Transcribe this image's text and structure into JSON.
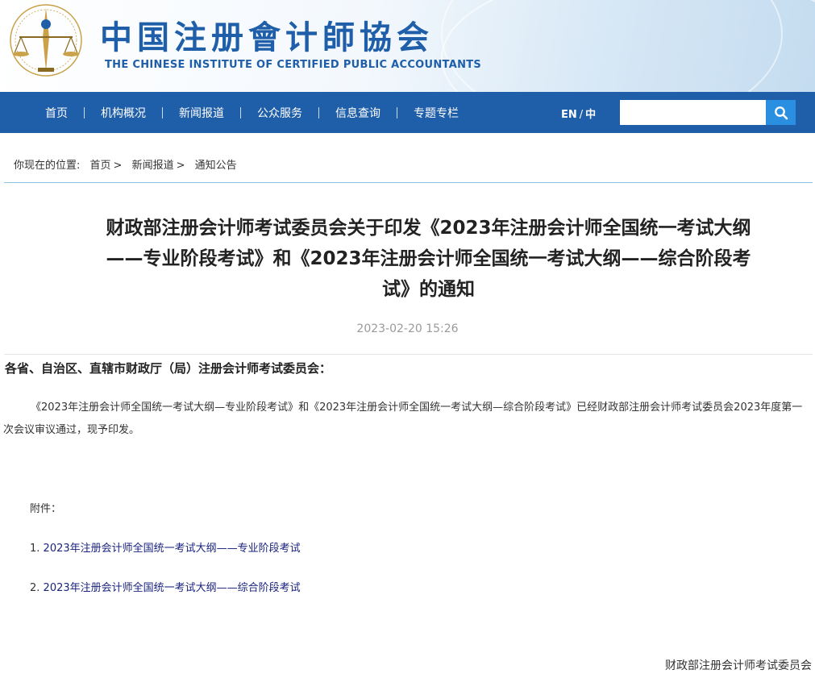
{
  "header": {
    "name_cn": "中国注册會计師協会",
    "name_en": "THE CHINESE INSTITUTE OF CERTIFIED PUBLIC ACCOUNTANTS"
  },
  "nav": {
    "items": [
      "首页",
      "机构概况",
      "新闻报道",
      "公众服务",
      "信息查询",
      "专题专栏"
    ],
    "lang_en": "EN",
    "lang_slash": "/",
    "lang_cn": "中"
  },
  "search": {
    "placeholder": "",
    "icon": "search-icon"
  },
  "breadcrumb": {
    "prefix": "你现在的位置:",
    "items": [
      "首页",
      "新闻报道",
      "通知公告"
    ],
    "separator": ">"
  },
  "article": {
    "title": "财政部注册会计师考试委员会关于印发《2023年注册会计师全国统一考试大纲——专业阶段考试》和《2023年注册会计师全国统一考试大纲——综合阶段考试》的通知",
    "date": "2023-02-20 15:26",
    "salutation": "各省、自治区、直辖市财政厅（局）注册会计师考试委员会：",
    "body": "《2023年注册会计师全国统一考试大纲—专业阶段考试》和《2023年注册会计师全国统一考试大纲—综合阶段考试》已经财政部注册会计师考试委员会2023年度第一次会议审议通过，现予印发。",
    "attachments_label": "附件：",
    "attachments": [
      {
        "num": "1.",
        "text": "2023年注册会计师全国统一考试大纲——专业阶段考试"
      },
      {
        "num": "2.",
        "text": "2023年注册会计师全国统一考试大纲——综合阶段考试"
      }
    ],
    "signoff": "财政部注册会计师考试委员会"
  },
  "colors": {
    "nav_bg": "#1f5ea8",
    "search_btn": "#2a8fe0",
    "link": "#1a237e",
    "brand": "#1f5ea8"
  }
}
